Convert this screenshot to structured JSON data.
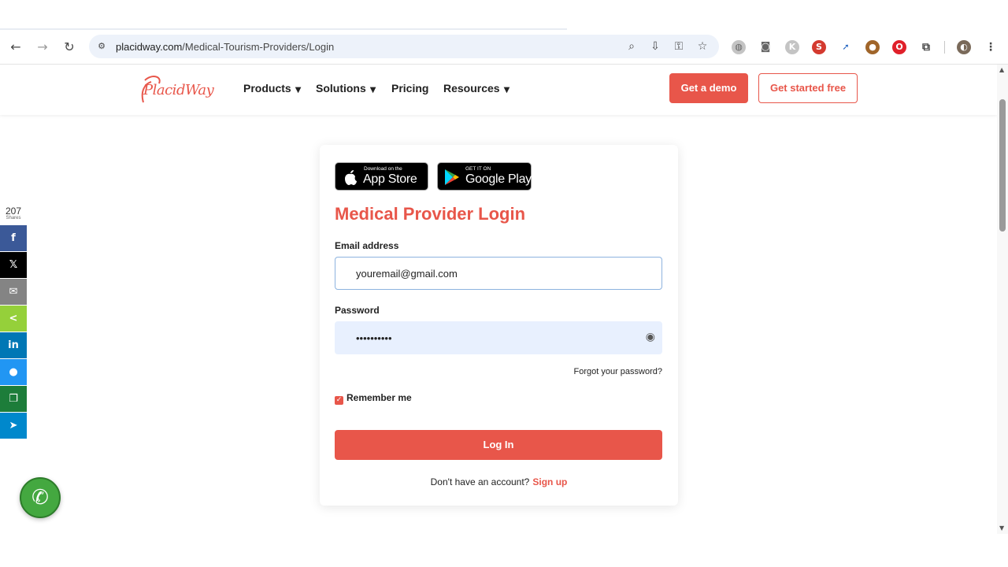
{
  "browser": {
    "url_host": "placidway.com",
    "url_path": "/Medical-Tourism-Providers/Login"
  },
  "header": {
    "logo_text": "PlacidWay",
    "nav": [
      {
        "label": "Products",
        "has_dropdown": true
      },
      {
        "label": "Solutions",
        "has_dropdown": true
      },
      {
        "label": "Pricing",
        "has_dropdown": false
      },
      {
        "label": "Resources",
        "has_dropdown": true
      }
    ],
    "demo_label": "Get a demo",
    "start_label": "Get started free",
    "accent_color": "#e8564a"
  },
  "stores": {
    "apple_small": "Download on the",
    "apple_big": "App Store",
    "google_small": "GET IT ON",
    "google_big": "Google Play"
  },
  "login": {
    "title": "Medical Provider Login",
    "email_label": "Email address",
    "email_value": "youremail@gmail.com",
    "password_label": "Password",
    "password_value": "••••••••••",
    "forgot_label": "Forgot your password?",
    "remember_label": "Remember me",
    "remember_checked": true,
    "login_label": "Log In",
    "no_account_text": "Don't have an account?",
    "signup_label": "Sign up"
  },
  "share": {
    "count": "207",
    "count_label": "Shares",
    "buttons": [
      {
        "name": "facebook",
        "glyph": "f",
        "color": "#3b5998"
      },
      {
        "name": "x",
        "glyph": "𝕏",
        "color": "#000000"
      },
      {
        "name": "email",
        "glyph": "✉",
        "color": "#848484"
      },
      {
        "name": "sharethis",
        "glyph": "<",
        "color": "#95d03a"
      },
      {
        "name": "linkedin",
        "glyph": "in",
        "color": "#0077b5"
      },
      {
        "name": "messenger",
        "glyph": "●",
        "color": "#2196f3"
      },
      {
        "name": "copy",
        "glyph": "❐",
        "color": "#1d7d3a"
      },
      {
        "name": "telegram",
        "glyph": "➤",
        "color": "#0088cc"
      }
    ]
  }
}
